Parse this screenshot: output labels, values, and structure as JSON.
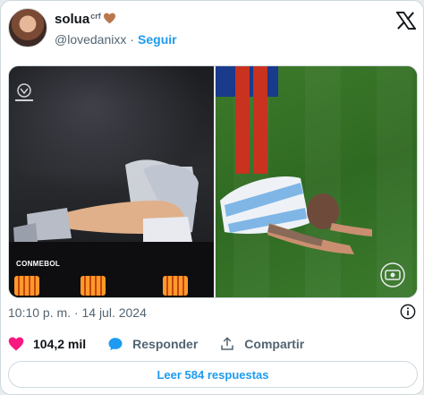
{
  "author": {
    "display_name": "solua",
    "name_superscript": "crf",
    "name_emoji_icon": "brown-heart-icon",
    "handle": "@lovedanixx",
    "separator": "·",
    "follow_label": "Seguir"
  },
  "platform_icon": "x-logo-icon",
  "media": {
    "left_watermark": "CONMEBOL",
    "left_corner_logo": "conmebol-logo-icon",
    "right_corner_logo": "broadcaster-logo-icon"
  },
  "tweet": {
    "timestamp": "10:10 p. m. · 14 jul. 2024",
    "info_icon": "info-icon"
  },
  "actions": {
    "like_icon": "heart-icon",
    "like_count": "104,2 mil",
    "reply_icon": "reply-bubble-icon",
    "reply_label": "Responder",
    "share_icon": "share-icon",
    "share_label": "Compartir"
  },
  "read_replies_label": "Leer 584 respuestas",
  "colors": {
    "accent": "#1d9bf0",
    "like": "#f91880",
    "muted_text": "#536471",
    "border": "#cfd9de"
  }
}
